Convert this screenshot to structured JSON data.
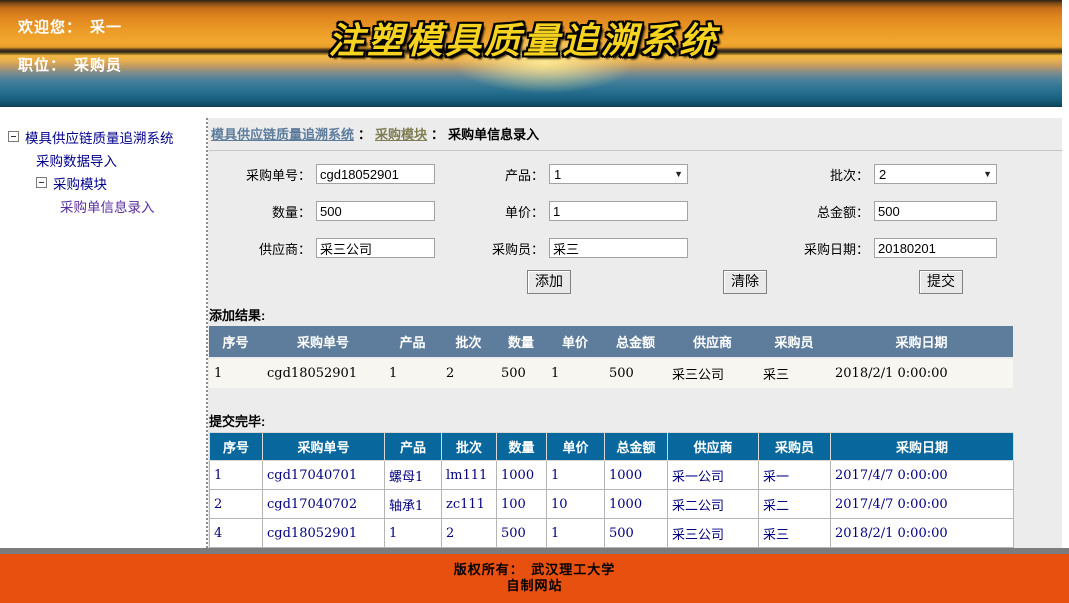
{
  "header": {
    "welcome_label": "欢迎您：",
    "welcome_name": "采一",
    "position_label": "职位：",
    "position_value": "采购员",
    "title": "注塑模具质量追溯系统"
  },
  "sidebar": {
    "root_label": "模具供应链质量追溯系统",
    "item_data_import": "采购数据导入",
    "item_purchase_module": "采购模块",
    "item_order_entry": "采购单信息录入"
  },
  "breadcrumb": {
    "system": "模具供应链质量追溯系统",
    "separator": "：",
    "module": "采购模块",
    "current": "采购单信息录入"
  },
  "form": {
    "order_no": {
      "label": "采购单号：",
      "value": "cgd18052901"
    },
    "product": {
      "label": "产品：",
      "value": "1"
    },
    "batch": {
      "label": "批次：",
      "value": "2"
    },
    "quantity": {
      "label": "数量：",
      "value": "500"
    },
    "unit_price": {
      "label": "单价：",
      "value": "1"
    },
    "total_amount": {
      "label": "总金额：",
      "value": "500"
    },
    "supplier": {
      "label": "供应商：",
      "value": "采三公司"
    },
    "purchaser": {
      "label": "采购员：",
      "value": "采三"
    },
    "purchase_date": {
      "label": "采购日期：",
      "value": "20180201"
    },
    "buttons": {
      "add": "添加",
      "clear": "清除",
      "submit": "提交"
    }
  },
  "add_result": {
    "label": "添加结果:",
    "columns": [
      "序号",
      "采购单号",
      "产品",
      "批次",
      "数量",
      "单价",
      "总金额",
      "供应商",
      "采购员",
      "采购日期"
    ],
    "rows": [
      [
        "1",
        "cgd18052901",
        "1",
        "2",
        "500",
        "1",
        "500",
        "采三公司",
        "采三",
        "2018/2/1 0:00:00"
      ]
    ]
  },
  "submitted": {
    "label": "提交完毕:",
    "columns": [
      "序号",
      "采购单号",
      "产品",
      "批次",
      "数量",
      "单价",
      "总金额",
      "供应商",
      "采购员",
      "采购日期"
    ],
    "rows": [
      [
        "1",
        "cgd17040701",
        "螺母1",
        "lm111",
        "1000",
        "1",
        "1000",
        "采一公司",
        "采一",
        "2017/4/7 0:00:00"
      ],
      [
        "2",
        "cgd17040702",
        "轴承1",
        "zc111",
        "100",
        "10",
        "1000",
        "采二公司",
        "采二",
        "2017/4/7 0:00:00"
      ],
      [
        "4",
        "cgd18052901",
        "1",
        "2",
        "500",
        "1",
        "500",
        "采三公司",
        "采三",
        "2018/2/1 0:00:00"
      ]
    ]
  },
  "footer": {
    "line1": "版权所有：　武汉理工大学",
    "line2": "自制网站"
  },
  "colors": {
    "result_table_header": "#5e7d9c",
    "grid_table_header": "#08689e",
    "grid_text_navy": "#000080",
    "footer_orange": "#e8500f",
    "breadcrumb_link_blue": "#5e7d9c",
    "breadcrumb_link_olive": "#7f7d52",
    "sidebar_text": "#00008b",
    "title_yellow": "#f6d31e"
  }
}
